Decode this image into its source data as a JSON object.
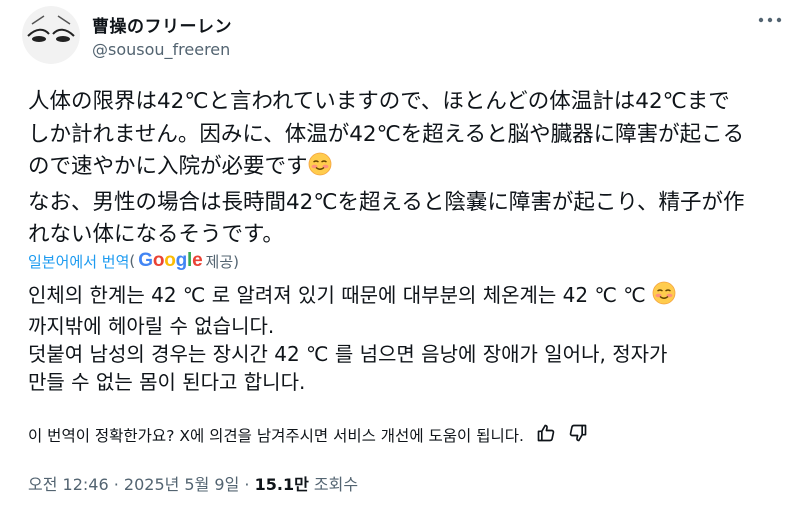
{
  "author": {
    "name": "曹操のフリーレン",
    "handle": "@sousou_freeren"
  },
  "tweet": {
    "text": "人体の限界は42℃と言われていますので、ほとんどの体温計は42℃まで\nしか計れません。因みに、体温が42℃を超えると脳や臓器に障害が起こる\nので速やかに入院が必要です",
    "text_cont": "\nなお、男性の場合は長時間42℃を超えると陰嚢に障害が起こり、精子が作\nれない体になるそうです。"
  },
  "translation": {
    "link_label": "일본어에서 번역",
    "paren_open": "(",
    "provider": "Google",
    "provided": " 제공)",
    "text_part1": "인체의 한계는 42 ℃ 로 알려져 있기 때문에 대부분의 체온계는 42 ℃ ℃ ",
    "text_part2": "\n까지밖에 헤아릴 수 없습니다.\n덧붙여 남성의 경우는 장시간 42 ℃ 를 넘으면 음낭에 장애가 일어나, 정자가\n만들 수 없는 몸이 된다고 합니다."
  },
  "feedback": {
    "question": "이 번역이 정확한가요? X에 의견을 남겨주시면 서비스 개선에 도움이 됩니다."
  },
  "meta": {
    "time": "오전 12:46",
    "sep1": " · ",
    "date": "2025년 5월 9일",
    "sep2": " · ",
    "views_count": "15.1만",
    "views_label": " 조회수"
  },
  "icons": {
    "more": "more-horizontal-icon",
    "emoji": "smiling-face-emoji",
    "like": "thumbs-up-icon",
    "dislike": "thumbs-down-icon"
  },
  "colors": {
    "link": "#1d9bf0",
    "secondary": "#536471",
    "text": "#0f1419"
  }
}
